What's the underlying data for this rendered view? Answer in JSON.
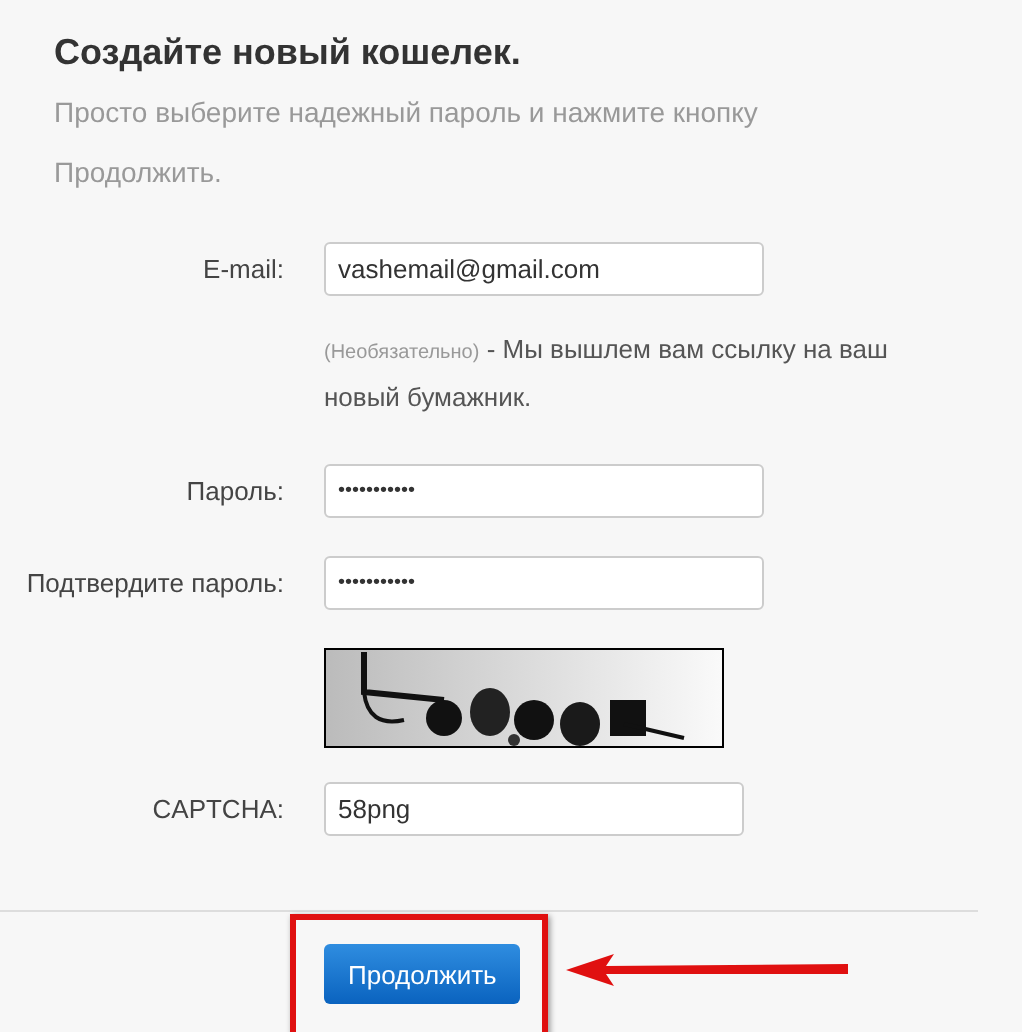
{
  "title": "Создайте новый кошелек.",
  "intro": "Просто выберите надежный пароль и нажмите кнопку Продолжить.",
  "fields": [
    {
      "kind": "text",
      "label": "E-mail:",
      "value": "vashemail@gmail.com",
      "hint": {
        "note": "(Необязательно)",
        "text": "- Мы вышлем вам ссылку на ваш новый бумажник."
      }
    },
    {
      "kind": "password",
      "label": "Пароль:",
      "value": "•••••••••••"
    },
    {
      "kind": "password",
      "label": "Подтвердите пароль:",
      "value": "•••••••••••"
    },
    {
      "kind": "captcha",
      "label": "CAPTCHA:",
      "value": "58png"
    }
  ],
  "submit": {
    "label": "Продолжить",
    "highlighted": true
  }
}
